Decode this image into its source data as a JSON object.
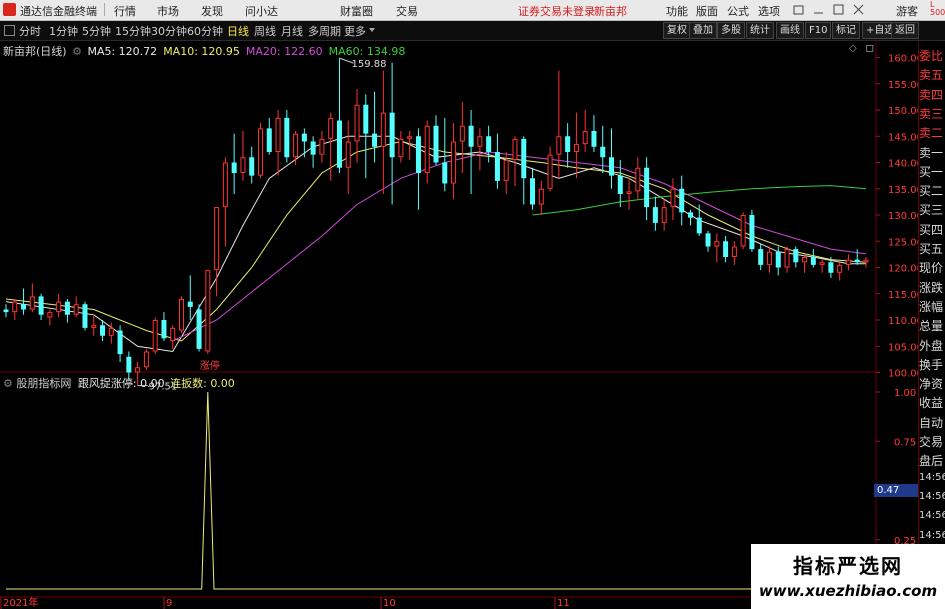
{
  "titlebar": {
    "app_name": "通达信金融终端",
    "menu": [
      "行情",
      "市场",
      "发现",
      "问小达",
      "财富圈",
      "交易"
    ],
    "notice": "证券交易未登录",
    "stock_short": "新亩邦",
    "right_menu": [
      "功能",
      "版面",
      "公式",
      "选项"
    ],
    "user": "游客",
    "badge_top": "L",
    "badge_bottom": "500"
  },
  "toolbar": {
    "periods": [
      "分时",
      "1分钟",
      "5分钟",
      "15分钟",
      "30分钟",
      "60分钟",
      "日线",
      "周线",
      "月线",
      "多周期",
      "更多"
    ],
    "active_period": "日线",
    "right_buttons": [
      "复权",
      "叠加",
      "多股",
      "统计",
      "画线",
      "F10",
      "标记",
      "+自选",
      "返回"
    ]
  },
  "main_chart": {
    "stock_label": "新亩邦(日线)",
    "ma_legend": [
      {
        "name": "MA5",
        "value": "120.72",
        "color": "#e8e8e8"
      },
      {
        "name": "MA10",
        "value": "120.95",
        "color": "#ecec73"
      },
      {
        "name": "MA20",
        "value": "122.60",
        "color": "#d24bdb"
      },
      {
        "name": "MA60",
        "value": "134.98",
        "color": "#3bcf3b"
      }
    ],
    "high_label": "159.88",
    "low_label": "97.51",
    "event_label": "涨停"
  },
  "sub_chart": {
    "indicator_name": "股朋指标网",
    "line_name": "跟风捉涨停",
    "line_value": "0.00",
    "second_name": "连扳数",
    "second_value": "0.00",
    "highlight_value": "0.47"
  },
  "x_axis": {
    "labels": [
      "2021年",
      "9",
      "10",
      "11"
    ]
  },
  "right_panel": {
    "labels": [
      "委比",
      "卖五",
      "卖四",
      "卖三",
      "卖二",
      "卖一",
      "买一",
      "买二",
      "买三",
      "买四",
      "买五",
      "现价",
      "涨跌",
      "涨幅",
      "总量",
      "外盘",
      "换手",
      "净资",
      "收益",
      "自动",
      "交易",
      "盘后",
      "14:56",
      "14:56",
      "14:56",
      "14:56",
      "14:56",
      "14:56",
      "14:56"
    ]
  },
  "watermark": {
    "title": "指标严选网",
    "url": "www.xuezhibiao.com"
  },
  "colors": {
    "up": "#ff3232",
    "down": "#54ffff",
    "ma5": "#e8e8e8",
    "ma10": "#ecec73",
    "ma20": "#d24bdb",
    "ma60": "#3bcf3b",
    "grid": "#6b0000",
    "signal": "#ecec73"
  },
  "chart_data": [
    {
      "type": "candlestick",
      "title": "新亩邦(日线)",
      "x_tick_labels": [
        "2021年",
        "9",
        "10",
        "11"
      ],
      "ylim": [
        97,
        162
      ],
      "y_ticks": [
        100.0,
        105.0,
        110.0,
        115.0,
        120.0,
        125.0,
        130.0,
        135.0,
        140.0,
        145.0,
        150.0,
        155.0,
        160.0
      ],
      "candles": [
        [
          112,
          113,
          110.5,
          111.5
        ],
        [
          111.5,
          114,
          110,
          113.5
        ],
        [
          113,
          116,
          111,
          112
        ],
        [
          112,
          117,
          111.5,
          114.5
        ],
        [
          114.5,
          115,
          110,
          111
        ],
        [
          110.5,
          112,
          109,
          111.5
        ],
        [
          111.5,
          115,
          110.5,
          113.5
        ],
        [
          113.5,
          114,
          109.5,
          111
        ],
        [
          111,
          114.5,
          110.5,
          113
        ],
        [
          113,
          113.5,
          108,
          108.5
        ],
        [
          108.5,
          111,
          107,
          109
        ],
        [
          109,
          110,
          106,
          107
        ],
        [
          107,
          109.5,
          105.5,
          108.5
        ],
        [
          108,
          109,
          102,
          103.5
        ],
        [
          103,
          104,
          98.5,
          100
        ],
        [
          100,
          102,
          97.5,
          101
        ],
        [
          101,
          104.5,
          100.5,
          104
        ],
        [
          104,
          110.5,
          103.5,
          110
        ],
        [
          110,
          111.5,
          106,
          106.5
        ],
        [
          106,
          109,
          104.5,
          108.5
        ],
        [
          108,
          114.5,
          107.5,
          114
        ],
        [
          113.5,
          118.5,
          110,
          112.5
        ],
        [
          112,
          113,
          104,
          104.5
        ],
        [
          104,
          119.5,
          103.5,
          119.5
        ],
        [
          119.5,
          131.5,
          114.5,
          131.5
        ],
        [
          131.5,
          141,
          124,
          140
        ],
        [
          140,
          145.5,
          134,
          138
        ],
        [
          138,
          146,
          136.5,
          141
        ],
        [
          141,
          143,
          136,
          137.5
        ],
        [
          137.5,
          147.5,
          137,
          146.5
        ],
        [
          146.5,
          148.5,
          141.5,
          142
        ],
        [
          142,
          150,
          137.5,
          148.5
        ],
        [
          148.5,
          150,
          140,
          141
        ],
        [
          141,
          146,
          139.5,
          145.5
        ],
        [
          145.5,
          146.5,
          141,
          144
        ],
        [
          144,
          145,
          139,
          141.5
        ],
        [
          141.5,
          146,
          140,
          144.5
        ],
        [
          144.5,
          149.5,
          136.5,
          148.5
        ],
        [
          148,
          159.9,
          138,
          139
        ],
        [
          139,
          148,
          134,
          144
        ],
        [
          144,
          154,
          140,
          151
        ],
        [
          151,
          153,
          137,
          145.5
        ],
        [
          145.5,
          153.5,
          140,
          143
        ],
        [
          143,
          157.5,
          134,
          149.5
        ],
        [
          149.5,
          159,
          132,
          141
        ],
        [
          141,
          146,
          140,
          144.5
        ],
        [
          144.5,
          146,
          140.5,
          145
        ],
        [
          145,
          146.5,
          131,
          138
        ],
        [
          138,
          148,
          136,
          147
        ],
        [
          147,
          149,
          139.5,
          140
        ],
        [
          140,
          148.5,
          134.5,
          136
        ],
        [
          136,
          147.5,
          133,
          144
        ],
        [
          144,
          151.5,
          138,
          147
        ],
        [
          147,
          150,
          134,
          143
        ],
        [
          143,
          146.5,
          138.5,
          145
        ],
        [
          145,
          147,
          140,
          142
        ],
        [
          142,
          145.5,
          135,
          136.5
        ],
        [
          136.5,
          142,
          134,
          140.5
        ],
        [
          140.5,
          145,
          135.5,
          144.5
        ],
        [
          144.5,
          145,
          132,
          137
        ],
        [
          137,
          139,
          131,
          132
        ],
        [
          132,
          136.5,
          130,
          135
        ],
        [
          135,
          143,
          134.5,
          141.5
        ],
        [
          141.5,
          157.5,
          137,
          145
        ],
        [
          145,
          147.5,
          139,
          142
        ],
        [
          142,
          149.5,
          137,
          143.5
        ],
        [
          143.5,
          150,
          142,
          146
        ],
        [
          146,
          149,
          142,
          143
        ],
        [
          143,
          147,
          138,
          141
        ],
        [
          141,
          146.5,
          135,
          137.5
        ],
        [
          137.5,
          140.5,
          131.5,
          134
        ],
        [
          134,
          137,
          131,
          134.5
        ],
        [
          134.5,
          141,
          133,
          139
        ],
        [
          139,
          141,
          129,
          131.5
        ],
        [
          131.5,
          133.5,
          127,
          128.5
        ],
        [
          128.5,
          133,
          127,
          131.5
        ],
        [
          131.5,
          137,
          129,
          135
        ],
        [
          135,
          137.5,
          128,
          130.5
        ],
        [
          130.5,
          131,
          128,
          129.5
        ],
        [
          129.5,
          132,
          126,
          126.5
        ],
        [
          126.5,
          127,
          123,
          124
        ],
        [
          124,
          126.5,
          121,
          125
        ],
        [
          125,
          126,
          121,
          122
        ],
        [
          122,
          125,
          120.5,
          124
        ],
        [
          124,
          130.5,
          123.5,
          130
        ],
        [
          130,
          131,
          123,
          123.5
        ],
        [
          123.5,
          124.5,
          119.5,
          120.5
        ],
        [
          120.5,
          124,
          119,
          123
        ],
        [
          123,
          124,
          118.5,
          120
        ],
        [
          120,
          124,
          119,
          123.5
        ],
        [
          123.5,
          124,
          120,
          121
        ],
        [
          121,
          122.5,
          119,
          122
        ],
        [
          122,
          123.5,
          120,
          120.5
        ],
        [
          120.5,
          121.5,
          119,
          121
        ],
        [
          121,
          122,
          118,
          119
        ],
        [
          119,
          121,
          117.5,
          120.5
        ],
        [
          120.5,
          122.5,
          119.5,
          121.5
        ],
        [
          121.5,
          123.5,
          120.5,
          121
        ],
        [
          121,
          122,
          120,
          121.5
        ]
      ],
      "ma": {
        "MA5": [
          [
            0,
            113.5
          ],
          [
            10,
            111
          ],
          [
            15,
            105
          ],
          [
            19,
            104
          ],
          [
            24,
            118
          ],
          [
            27,
            128
          ],
          [
            30,
            137
          ],
          [
            35,
            143
          ],
          [
            39,
            145
          ],
          [
            44,
            145
          ],
          [
            49,
            141
          ],
          [
            54,
            142
          ],
          [
            58,
            140
          ],
          [
            63,
            137
          ],
          [
            67,
            139
          ],
          [
            71,
            137
          ],
          [
            75,
            133
          ],
          [
            79,
            129
          ],
          [
            84,
            126
          ],
          [
            88,
            123
          ],
          [
            92,
            122
          ],
          [
            96,
            120.7
          ],
          [
            98,
            120.7
          ]
        ],
        "MA10": [
          [
            0,
            114
          ],
          [
            10,
            112
          ],
          [
            16,
            108
          ],
          [
            20,
            106
          ],
          [
            24,
            112
          ],
          [
            28,
            120
          ],
          [
            32,
            130
          ],
          [
            36,
            138
          ],
          [
            40,
            142
          ],
          [
            45,
            144
          ],
          [
            50,
            142
          ],
          [
            56,
            141
          ],
          [
            61,
            140
          ],
          [
            65,
            139
          ],
          [
            70,
            138
          ],
          [
            75,
            135
          ],
          [
            80,
            130
          ],
          [
            85,
            126
          ],
          [
            90,
            123
          ],
          [
            94,
            121.5
          ],
          [
            98,
            121
          ]
        ],
        "MA20": [
          [
            19,
            106
          ],
          [
            24,
            110
          ],
          [
            30,
            118
          ],
          [
            36,
            126
          ],
          [
            40,
            132
          ],
          [
            45,
            137
          ],
          [
            50,
            140
          ],
          [
            55,
            142
          ],
          [
            60,
            141
          ],
          [
            65,
            140
          ],
          [
            70,
            139
          ],
          [
            75,
            136
          ],
          [
            80,
            132
          ],
          [
            85,
            128
          ],
          [
            90,
            125.5
          ],
          [
            94,
            123.5
          ],
          [
            98,
            122.6
          ]
        ],
        "MA60": [
          [
            60,
            130
          ],
          [
            65,
            131
          ],
          [
            70,
            132.5
          ],
          [
            75,
            133.5
          ],
          [
            80,
            134.3
          ],
          [
            85,
            135
          ],
          [
            90,
            135.4
          ],
          [
            94,
            135.6
          ],
          [
            98,
            135
          ]
        ]
      },
      "annotations": [
        {
          "text": "159.88",
          "x": 38,
          "y": 159.88
        },
        {
          "text": "97.51",
          "x": 15,
          "y": 97.51
        },
        {
          "text": "涨停",
          "x": 23
        }
      ]
    },
    {
      "type": "line",
      "title": "跟风捉涨停",
      "ylim": [
        0,
        1.0
      ],
      "y_ticks": [
        0.25,
        0.5,
        0.75,
        1.0
      ],
      "series": [
        {
          "name": "跟风捉涨停",
          "points": [
            [
              0,
              0
            ],
            [
              22.3,
              0
            ],
            [
              23,
              1.0
            ],
            [
              23.7,
              0
            ],
            [
              98,
              0
            ]
          ]
        }
      ]
    }
  ]
}
